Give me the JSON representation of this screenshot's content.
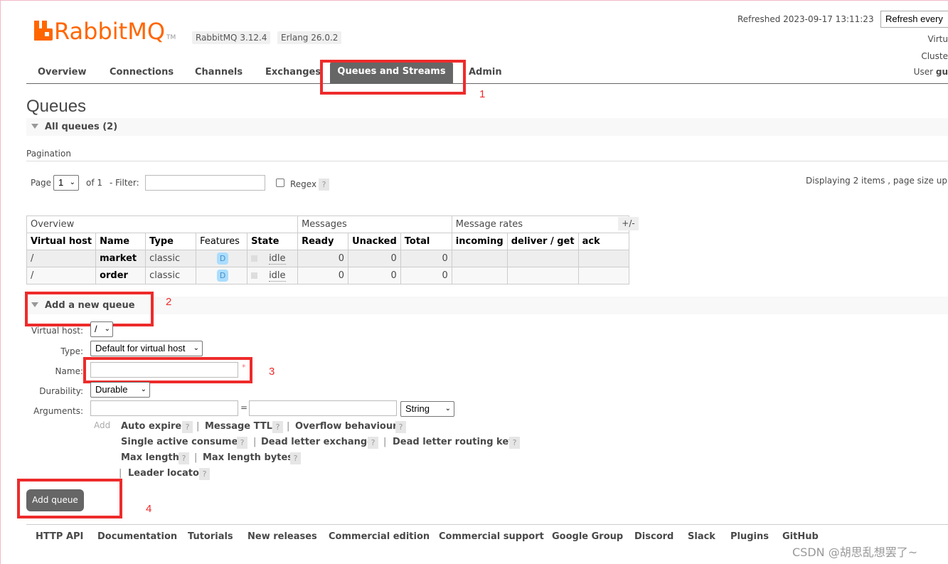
{
  "header": {
    "logo_text": "RabbitMQ",
    "logo_tm": "TM",
    "rabbitmq_version": "RabbitMQ 3.12.4",
    "erlang_version": "Erlang 26.0.2",
    "refreshed": "Refreshed 2023-09-17 13:11:23",
    "refresh_select": "Refresh every",
    "virtual_host_label": "Virtu",
    "cluster_label": "Cluste",
    "user_label": "User",
    "user_value": "gu"
  },
  "nav": {
    "overview": "Overview",
    "connections": "Connections",
    "channels": "Channels",
    "exchanges": "Exchanges",
    "queues": "Queues and Streams",
    "admin": "Admin"
  },
  "annotations": {
    "n1": "1",
    "n2": "2",
    "n3": "3",
    "n4": "4"
  },
  "page": {
    "title": "Queues",
    "all_queues": "All queues (2)",
    "pagination_label": "Pagination",
    "page_label": "Page",
    "page_value": "1",
    "of_label": "of 1",
    "filter_label": "- Filter:",
    "regex_label": "Regex",
    "help": "?",
    "displaying": "Displaying 2 items , page size up"
  },
  "table": {
    "groups": [
      "Overview",
      "Messages",
      "Message rates"
    ],
    "columns": [
      "Virtual host",
      "Name",
      "Type",
      "Features",
      "State",
      "Ready",
      "Unacked",
      "Total",
      "incoming",
      "deliver / get",
      "ack"
    ],
    "plus_minus": "+/-",
    "rows": [
      {
        "vhost": "/",
        "name": "market",
        "type": "classic",
        "feature": "D",
        "state": "idle",
        "ready": "0",
        "unacked": "0",
        "total": "0"
      },
      {
        "vhost": "/",
        "name": "order",
        "type": "classic",
        "feature": "D",
        "state": "idle",
        "ready": "0",
        "unacked": "0",
        "total": "0"
      }
    ]
  },
  "form": {
    "section_title": "Add a new queue",
    "vhost_label": "Virtual host:",
    "vhost_value": "/",
    "type_label": "Type:",
    "type_value": "Default for virtual host",
    "name_label": "Name:",
    "name_value": "",
    "required_mark": "*",
    "durability_label": "Durability:",
    "durability_value": "Durable",
    "arguments_label": "Arguments:",
    "equals": "=",
    "arg_type": "String",
    "add_link": "Add",
    "arg_links": {
      "auto_expire": "Auto expire",
      "message_ttl": "Message TTL",
      "overflow": "Overflow behaviour",
      "single_active": "Single active consumer",
      "dlx": "Dead letter exchange",
      "dlrk": "Dead letter routing key",
      "max_length": "Max length",
      "max_length_bytes": "Max length bytes",
      "leader_locator": "Leader locator"
    },
    "sep": "|",
    "submit": "Add queue"
  },
  "footer": {
    "links": [
      "HTTP API",
      "Documentation",
      "Tutorials",
      "New releases",
      "Commercial edition",
      "Commercial support",
      "Google Group",
      "Discord",
      "Slack",
      "Plugins",
      "GitHub"
    ]
  },
  "watermark": "CSDN @胡思乱想罢了~",
  "colors": {
    "brand": "#ff6600",
    "nav_active": "#666666",
    "annotation": "#ee2b2b",
    "feature_badge": "#aaddff"
  }
}
